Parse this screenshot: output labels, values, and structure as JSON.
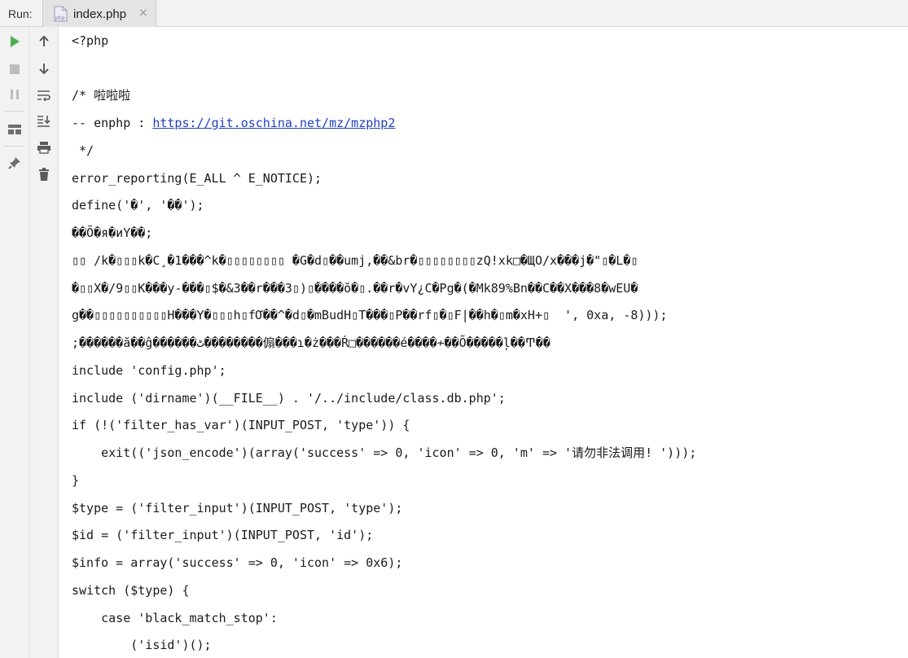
{
  "toolbar": {
    "run_label": "Run:",
    "tab_title": "index.php",
    "tab_icon_text": "php",
    "close_glyph": "×"
  },
  "colors": {
    "run_green": "#4caf50",
    "icon_gray": "#6e6e6e",
    "link_blue": "#1f3fbf"
  },
  "console": {
    "lines": [
      "<?php",
      "",
      "/* 啦啦啦",
      "-- enphp : ",
      " */",
      "error_reporting(E_ALL ^ E_NOTICE);",
      "define('�', '��');",
      "��Õ�я�иΥ��;",
      "▯▯ /k�▯▯▯k�C¸�1���^k�▯▯▯▯▯▯▯▯ �G�d▯��umj,��&br�▯▯▯▯▯▯▯▯zQ!xk□�ЩO/x���j�\"▯�L�▯",
      "�▯▯X�/9▯▯K���y-���▯$�&3��r���3▯)▯����ŏ�▯.��r�vY¿C�Pg�(�Mk89%Bn��C��X���8�wEU�",
      "g��▯▯▯▯▯▯▯▯▯▯H���Y�▯▯▯h▯fƠ��^�d▯�mBudH▯T���▯P��rf▯�▯F|��h�▯m�xH+▯  ', 0xa, -8)));",
      ";������ă��ĝ������ٹ��������傓���ɿ�ż���Ŕ□������é����≁��Õ�����ļ��Ͳ��",
      "include 'config.php';",
      "include ('dirname')(__FILE__) . '/../include/class.db.php';",
      "if (!('filter_has_var')(INPUT_POST, 'type')) {",
      "    exit(('json_encode')(array('success' => 0, 'icon' => 0, 'm' => '请勿非法调用! ')));",
      "}",
      "$type = ('filter_input')(INPUT_POST, 'type');",
      "$id = ('filter_input')(INPUT_POST, 'id');",
      "$info = array('success' => 0, 'icon' => 0x6);",
      "switch ($type) {",
      "    case 'black_match_stop':",
      "        ('isid')();"
    ],
    "link_text": "https://git.oschina.net/mz/mzphp2"
  }
}
